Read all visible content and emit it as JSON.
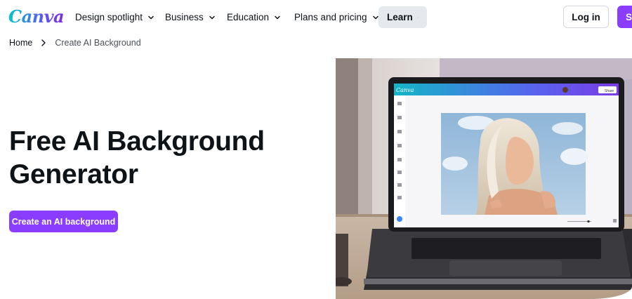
{
  "brand": {
    "logo_text": "Canva",
    "accent": "#8b3dff"
  },
  "nav": {
    "items": [
      {
        "label": "Design spotlight"
      },
      {
        "label": "Business"
      },
      {
        "label": "Education"
      },
      {
        "label": "Plans and pricing"
      },
      {
        "label": "Learn"
      }
    ],
    "login_label": "Log in",
    "signup_label": "Si"
  },
  "breadcrumb": {
    "home": "Home",
    "current": "Create AI Background"
  },
  "hero": {
    "title_line1": "Free AI Background",
    "title_line2": "Generator",
    "cta_label": "Create an AI background"
  },
  "editor_mock": {
    "logo_text": "Canva",
    "share_label": "Share"
  }
}
